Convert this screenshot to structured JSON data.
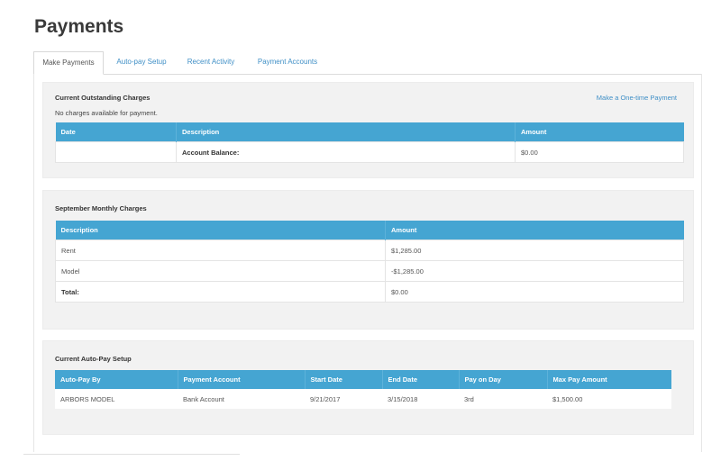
{
  "page": {
    "title": "Payments"
  },
  "tabs": [
    {
      "label": "Make Payments",
      "active": true
    },
    {
      "label": "Auto-pay Setup",
      "active": false
    },
    {
      "label": "Recent Activity",
      "active": false
    },
    {
      "label": "Payment Accounts",
      "active": false
    }
  ],
  "outstanding": {
    "title": "Current Outstanding Charges",
    "link": "Make a One-time Payment",
    "note": "No charges available for payment.",
    "headers": [
      "Date",
      "Description",
      "Amount"
    ],
    "row": {
      "date": "",
      "description": "Account Balance:",
      "amount": "$0.00"
    }
  },
  "monthly": {
    "title": "September Monthly Charges",
    "headers": [
      "Description",
      "Amount"
    ],
    "rows": [
      {
        "description": "Rent",
        "amount": "$1,285.00"
      },
      {
        "description": "Model",
        "amount": "-$1,285.00"
      },
      {
        "description": "Total:",
        "amount": "$0.00"
      }
    ]
  },
  "autopay": {
    "title": "Current Auto-Pay Setup",
    "headers": [
      "Auto-Pay By",
      "Payment Account",
      "Start Date",
      "End Date",
      "Pay on Day",
      "Max Pay Amount"
    ],
    "row": {
      "by": "ARBORS MODEL",
      "account": "Bank Account",
      "start": "9/21/2017",
      "end": "3/15/2018",
      "day": "3rd",
      "max": "$1,500.00"
    }
  },
  "colors": {
    "header_blue": "#45a5d2",
    "link_blue": "#3f8fc6",
    "panel_bg": "#f2f2f2"
  }
}
